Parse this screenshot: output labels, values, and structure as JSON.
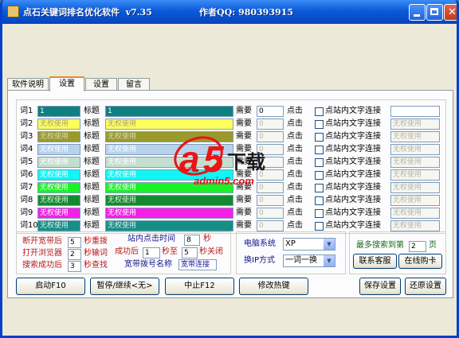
{
  "title_app": "点石关键词排名优化软件  v7.35",
  "title_author": "作者QQ: 980393915",
  "tabs": [
    "软件说明",
    "设置",
    "设置",
    "留言"
  ],
  "rows": [
    {
      "label": "词1",
      "kw": "1",
      "title_label": "标题",
      "title": "1",
      "need": "需要",
      "count": "0",
      "click": "点击",
      "chk": "点站内文字连接",
      "link": ""
    },
    {
      "label": "词2",
      "kw": "无权使用",
      "title_label": "标题",
      "title": "无权使用",
      "need": "需要",
      "count": "0",
      "click": "点击",
      "chk": "点站内文字连接",
      "link": "无权使用"
    },
    {
      "label": "词3",
      "kw": "无权使用",
      "title_label": "标题",
      "title": "无权使用",
      "need": "需要",
      "count": "0",
      "click": "点击",
      "chk": "点站内文字连接",
      "link": "无权使用"
    },
    {
      "label": "词4",
      "kw": "无权使用",
      "title_label": "标题",
      "title": "无权使用",
      "need": "需要",
      "count": "0",
      "click": "点击",
      "chk": "点站内文字连接",
      "link": "无权使用"
    },
    {
      "label": "词5",
      "kw": "无权使用",
      "title_label": "标题",
      "title": "无权使用",
      "need": "需要",
      "count": "0",
      "click": "点击",
      "chk": "点站内文字连接",
      "link": "无权使用"
    },
    {
      "label": "词6",
      "kw": "无权使用",
      "title_label": "标题",
      "title": "无权使用",
      "need": "需要",
      "count": "0",
      "click": "点击",
      "chk": "点站内文字连接",
      "link": "无权使用"
    },
    {
      "label": "词7",
      "kw": "无权使用",
      "title_label": "标题",
      "title": "无权使用",
      "need": "需要",
      "count": "0",
      "click": "点击",
      "chk": "点站内文字连接",
      "link": "无权使用"
    },
    {
      "label": "词8",
      "kw": "无权使用",
      "title_label": "标题",
      "title": "无权使用",
      "need": "需要",
      "count": "0",
      "click": "点击",
      "chk": "点站内文字连接",
      "link": "无权使用"
    },
    {
      "label": "词9",
      "kw": "无权使用",
      "title_label": "标题",
      "title": "无权使用",
      "need": "需要",
      "count": "0",
      "click": "点击",
      "chk": "点站内文字连接",
      "link": "无权使用"
    },
    {
      "label": "词10",
      "kw": "无权使用",
      "title_label": "标题",
      "title": "无权使用",
      "need": "需要",
      "count": "0",
      "click": "点击",
      "chk": "点站内文字连接",
      "link": "无权使用"
    }
  ],
  "row_colors": [
    {
      "kw": "#0e8080",
      "title": "#0e8080",
      "text": "#ffffff"
    },
    {
      "kw": "#feff5c",
      "title": "#feff5c",
      "text": "#a29e86"
    },
    {
      "kw": "#9a9a2a",
      "title": "#9a9a2a",
      "text": "#d9d8c2"
    },
    {
      "kw": "#b8d2ec",
      "title": "#b8d2ec",
      "text": "#ffffff"
    },
    {
      "kw": "#c3dfcf",
      "title": "#c3dfcf",
      "text": "#ffffff"
    },
    {
      "kw": "#11f5f5",
      "title": "#11f5f5",
      "text": "#ffffff"
    },
    {
      "kw": "#19f227",
      "title": "#19f227",
      "text": "#ffffff"
    },
    {
      "kw": "#138a30",
      "title": "#138a30",
      "text": "#d9f0d9"
    },
    {
      "kw": "#f51fe5",
      "title": "#f51fe5",
      "text": "#ffffff"
    },
    {
      "kw": "#158f86",
      "title": "#158f86",
      "text": "#d9f0ec"
    }
  ],
  "settings": {
    "disconnect_label": "断开宽带后",
    "disconnect_value": "5",
    "redial_label": "秒重拨",
    "open_browser_label": "打开浏览器",
    "open_browser_value": "2",
    "input_word_label": "秒输词",
    "after_search_label": "搜索成功后",
    "after_search_value": "3",
    "find_label": "秒查找",
    "onsite_click_label": "站内点击时间",
    "onsite_click_value": "8",
    "sec": "秒",
    "success_label": "成功后",
    "success_from": "1",
    "sec_to": "秒至",
    "success_to": "5",
    "sec_close": "秒关闭",
    "dial_name_label": "宽带拨号名称",
    "dial_name_value": "宽带连接"
  },
  "system": {
    "os_label": "电脑系统",
    "os_value": "XP",
    "ip_label": "换IP方式",
    "ip_value": "一词一换"
  },
  "search_depth": {
    "label": "最多搜索到第",
    "value": "2",
    "unit": "页"
  },
  "buttons": {
    "contact": "联系客服",
    "buy": "在线购卡",
    "start": "启动F10",
    "pause": "暂停/继续<无>",
    "stop": "中止F12",
    "hotkey": "修改热键",
    "save": "保存设置",
    "restore": "还原设置"
  },
  "watermark": {
    "logo": "a5",
    "download": "下载",
    "domain": "admin5.com"
  }
}
